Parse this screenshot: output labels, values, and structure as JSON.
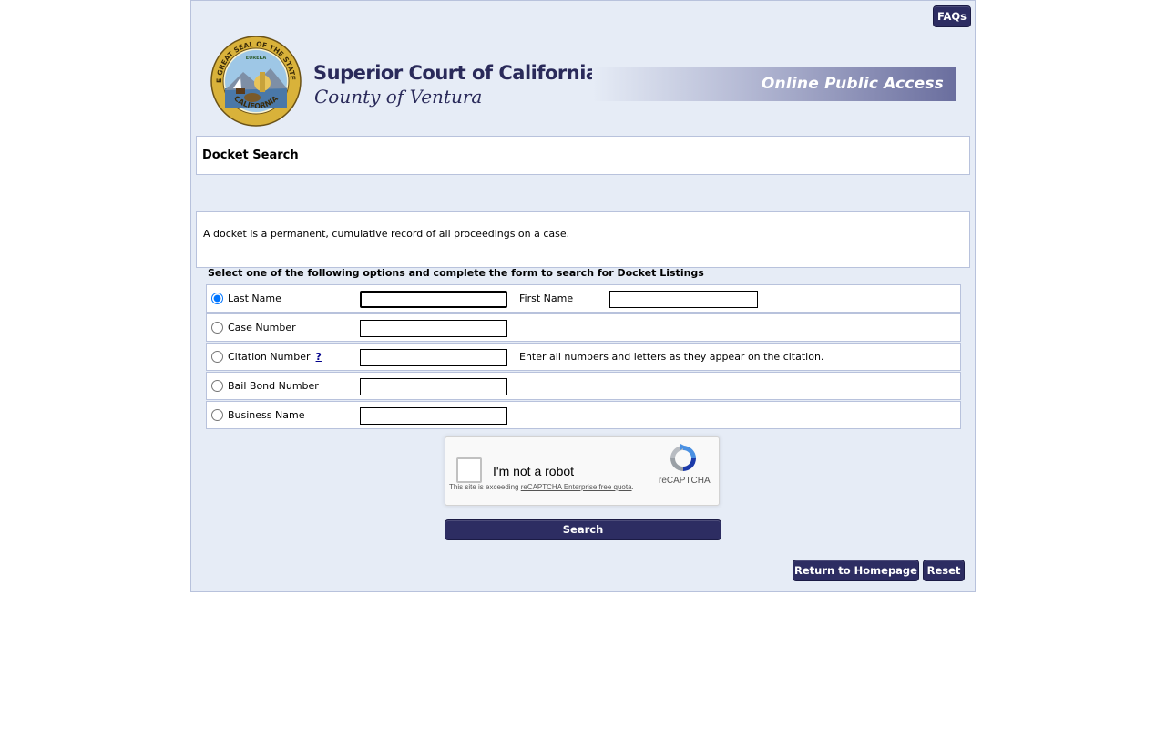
{
  "header": {
    "faq_label": "FAQs",
    "court_name": "Superior Court of California",
    "county": "County of Ventura",
    "portal_name": "Online Public Access",
    "seal_icon": "california-state-seal",
    "seal_lettering": [
      "THE GREAT SEAL OF THE STATE OF",
      "CALIFORNIA",
      "EUREKA"
    ]
  },
  "page": {
    "title": "Docket Search",
    "description": "A docket is a permanent, cumulative record of all proceedings on a case.",
    "instructions": "Select one of the following options and complete the form to search for Docket Listings"
  },
  "search_options": [
    {
      "label": "Last Name",
      "selected": true,
      "value": "",
      "second_field_label": "First Name",
      "second_value": ""
    },
    {
      "label": "Case Number",
      "selected": false,
      "value": ""
    },
    {
      "label": "Citation Number",
      "help": "?",
      "selected": false,
      "value": "",
      "hint": "Enter all numbers and letters as they appear on the citation."
    },
    {
      "label": "Bail Bond Number",
      "selected": false,
      "value": ""
    },
    {
      "label": "Business Name",
      "selected": false,
      "value": ""
    }
  ],
  "captcha": {
    "checkbox_label": "I'm not a robot",
    "brand": "reCAPTCHA",
    "notice_prefix": "This site is exceeding ",
    "notice_link": "reCAPTCHA Enterprise free quota",
    "notice_suffix": ".",
    "checked": false
  },
  "actions": {
    "search_label": "Search",
    "home_label": "Return to Homepage",
    "reset_label": "Reset"
  },
  "colors": {
    "button_bg": "#2d2d62",
    "page_bg": "#e6ecf6",
    "title_text": "#2a2a5a",
    "help_link": "#00008b"
  }
}
